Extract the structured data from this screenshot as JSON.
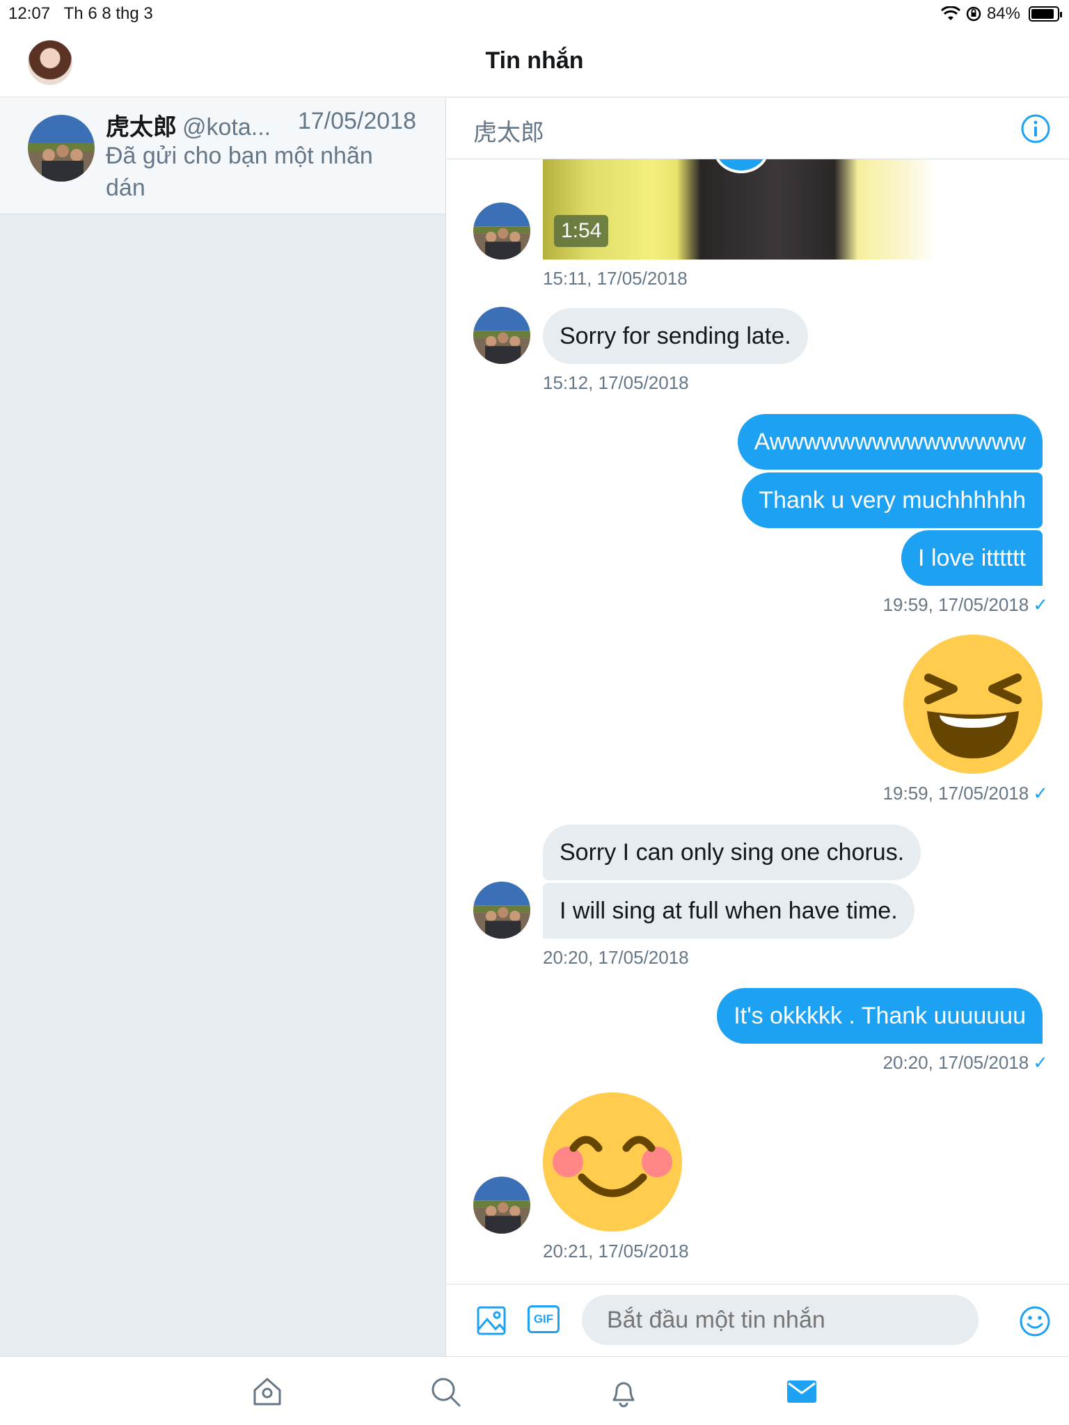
{
  "status_bar": {
    "time": "12:07",
    "date": "Th 6 8 thg 3",
    "battery": "84%"
  },
  "nav": {
    "title": "Tin nhắn"
  },
  "conversation": {
    "name": "虎太郎",
    "handle": "@kota...",
    "date": "17/05/2018",
    "preview": "Đã gửi cho bạn một nhãn dán"
  },
  "chat": {
    "header_name": "虎太郎",
    "video_duration": "1:54",
    "ts_video": "15:11, 17/05/2018",
    "msg_sorry_late": "Sorry for sending late.",
    "ts_sorry_late": "15:12, 17/05/2018",
    "out_1": "Awwwwwwwwwwwwwww",
    "out_2": "Thank u very muchhhhhh",
    "out_3": "I love itttttt",
    "ts_out_1": "19:59, 17/05/2018",
    "ts_sticker_out": "19:59, 17/05/2018",
    "in_chorus": "Sorry I can only sing one chorus.",
    "in_full": "I will sing at full when have time.",
    "ts_in_chorus": "20:20, 17/05/2018",
    "out_ok": "It's okkkkk . Thank uuuuuuu",
    "ts_out_ok": "20:20, 17/05/2018",
    "ts_sticker_in": "20:21, 17/05/2018",
    "read_mark": "✓"
  },
  "composer": {
    "placeholder": "Bắt đầu một tin nhắn",
    "gif_label": "GIF"
  },
  "colors": {
    "accent": "#1da1f2",
    "pane_bg": "#e6ecf0",
    "muted_text": "#657786"
  }
}
